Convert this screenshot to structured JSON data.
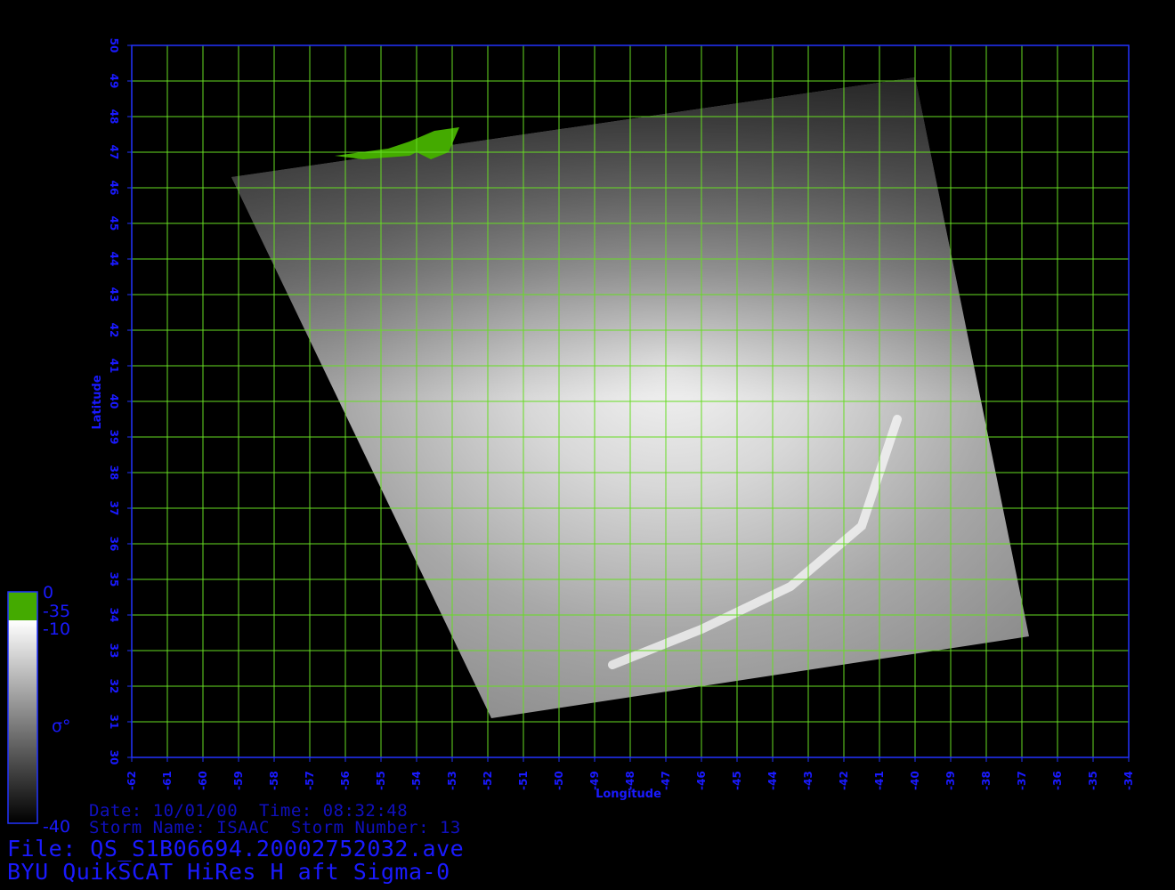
{
  "map": {
    "lon_range": [
      -62,
      -34
    ],
    "lat_range": [
      30,
      50
    ],
    "lon_ticks": [
      "-62",
      "-61",
      "-60",
      "-59",
      "-58",
      "-57",
      "-56",
      "-55",
      "-54",
      "-53",
      "-52",
      "-51",
      "-50",
      "-49",
      "-48",
      "-47",
      "-46",
      "-45",
      "-44",
      "-43",
      "-42",
      "-41",
      "-40",
      "-39",
      "-38",
      "-37",
      "-36",
      "-35",
      "-34"
    ],
    "lat_ticks": [
      "30",
      "31",
      "32",
      "33",
      "34",
      "35",
      "36",
      "37",
      "38",
      "39",
      "40",
      "41",
      "42",
      "43",
      "44",
      "45",
      "46",
      "47",
      "48",
      "49",
      "50"
    ],
    "xlabel": "Longitude",
    "ylabel": "Latitude",
    "grid": true,
    "grid_color": "#66dd22",
    "frame_color": "#2233ff",
    "tick_color": "#1a1aff",
    "swath_corners_lonlat": [
      [
        -59.2,
        46.3
      ],
      [
        -40.0,
        49.1
      ],
      [
        -36.8,
        33.4
      ],
      [
        -51.9,
        31.1
      ]
    ],
    "land_color": "#44aa00"
  },
  "colorbar": {
    "labels": [
      "0",
      "-35",
      "-10",
      "σ°",
      "-40"
    ],
    "land_range": [
      -35,
      0
    ],
    "sigma_range": [
      -40,
      -10
    ],
    "top_color": "#44aa00",
    "high_color": "#ffffff",
    "low_color": "#000000"
  },
  "info": {
    "date_line": "Date: 10/01/00  Time: 08:32:48",
    "storm_line": "Storm Name: ISAAC  Storm Number: 13",
    "file_line": "File: QS_S1B06694.20002752032.ave",
    "title_line": "BYU QuikSCAT HiRes H aft Sigma-0"
  }
}
